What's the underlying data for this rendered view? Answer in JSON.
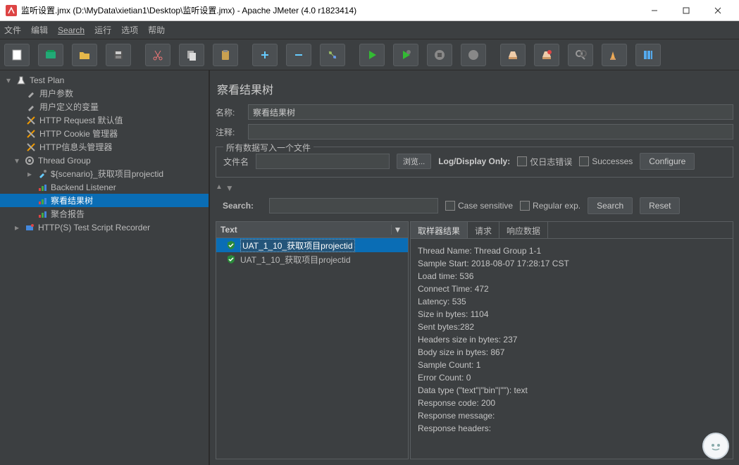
{
  "window": {
    "title": "监听设置.jmx (D:\\MyData\\xietian1\\Desktop\\监听设置.jmx) - Apache JMeter (4.0 r1823414)"
  },
  "menu": {
    "file": "文件",
    "edit": "编辑",
    "search": "Search",
    "run": "运行",
    "options": "选项",
    "help": "帮助"
  },
  "tree": {
    "testplan": "Test Plan",
    "userparams": "用户参数",
    "uservars": "用户定义的变量",
    "httpdefault": "HTTP Request 默认值",
    "cookiemgr": "HTTP Cookie 管理器",
    "headermgr": "HTTP信息头管理器",
    "threadgroup": "Thread Group",
    "scenario": "${scenario}_获取项目projectid",
    "backend": "Backend Listener",
    "viewtree": "察看结果树",
    "aggregate": "聚合报告",
    "recorder": "HTTP(S) Test Script Recorder"
  },
  "panel": {
    "title": "察看结果树",
    "name_label": "名称:",
    "name_value": "察看结果树",
    "comment_label": "注释:",
    "comment_value": "",
    "write_legend": "所有数据写入一个文件",
    "filename_label": "文件名",
    "filename_value": "",
    "browse": "浏览...",
    "logdisplay": "Log/Display Only:",
    "errorsonly": "仅日志错误",
    "successes": "Successes",
    "configure": "Configure",
    "search_label": "Search:",
    "case_sensitive": "Case sensitive",
    "regex": "Regular exp.",
    "search_btn": "Search",
    "reset_btn": "Reset",
    "text_header": "Text",
    "result1": "UAT_1_10_获取项目projectid",
    "result2": "UAT_1_10_获取项目projectid",
    "tab_sampler": "取样器结果",
    "tab_request": "请求",
    "tab_response": "响应数据",
    "detail": {
      "l1": "Thread Name: Thread Group 1-1",
      "l2": "Sample Start: 2018-08-07 17:28:17 CST",
      "l3": "Load time: 536",
      "l4": "Connect Time: 472",
      "l5": "Latency: 535",
      "l6": "Size in bytes: 1104",
      "l7": "Sent bytes:282",
      "l8": "Headers size in bytes: 237",
      "l9": "Body size in bytes: 867",
      "l10": "Sample Count: 1",
      "l11": "Error Count: 0",
      "l12": "Data type (\"text\"|\"bin\"|\"\"): text",
      "l13": "Response code: 200",
      "l14": "Response message:",
      "l15": "",
      "l16": "Response headers:"
    }
  }
}
